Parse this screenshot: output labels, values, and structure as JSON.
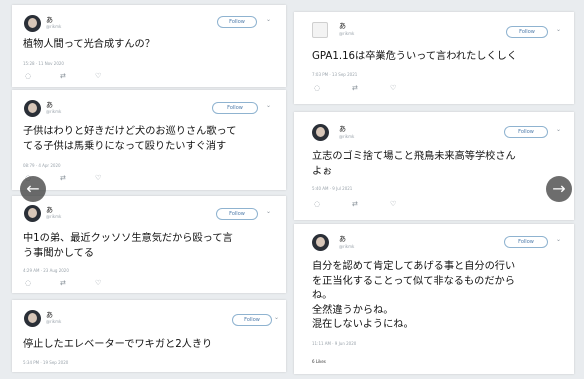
{
  "tweets": [
    {
      "name": "あ",
      "handle": "@rikmk",
      "follow": "Follow",
      "text": "植物人間って光合成すんの？",
      "meta": "15:28 · 11 Nov 2020"
    },
    {
      "name": "あ",
      "handle": "@rikmk",
      "follow": "Follow",
      "text": "子供はわりと好きだけど犬のお巡りさん歌って\nてる子供は馬乗りになって殴りたいすぐ消す",
      "meta": "08:79 · 4 Apr 2020"
    },
    {
      "name": "あ",
      "handle": "@rikmk",
      "follow": "Follow",
      "text": "中1の弟、最近クッソソ生意気だから殴って言\nう事聞かしてる",
      "meta": "4:29 AM · 23 Aug 2020"
    },
    {
      "name": "あ",
      "handle": "@rikmk",
      "follow": "Follow",
      "text": "停止したエレベーターでワキガと2人きり",
      "meta": "5:34 PM · 19 Sep 2020"
    },
    {
      "name": "あ",
      "handle": "@rikmk",
      "follow": "Follow",
      "text": "GPA1.16は卒業危ういって言われたしくしく",
      "meta": "7:03 PM · 13 Sep 2021"
    },
    {
      "name": "あ",
      "handle": "@rikmk",
      "follow": "Follow",
      "text": "立志のゴミ捨て場こと飛鳥未来高等学校さん\nよぉ",
      "meta": "5:40 AM · 9 Jul 2021"
    },
    {
      "name": "あ",
      "handle": "@rikmk",
      "follow": "Follow",
      "text": "自分を認めて肯定してあげる事と自分の行い\nを正当化することって似て非なるものだから\nね。\n全然違うからね。\n混在しないようにね。",
      "meta": "11:11 AM · 9 Jun 2020",
      "likes": "6 Likes"
    }
  ],
  "icons": {
    "reply": "comment-icon",
    "retweet": "retweet-icon",
    "like": "heart-icon",
    "chevron": "chevron-down-icon",
    "prev": "arrow-left-icon",
    "next": "arrow-right-icon"
  },
  "nav": {
    "prev": "←",
    "next": "→"
  },
  "actions": {
    "reply": "◌",
    "retweet": "⇄",
    "like": "♡",
    "chevron": "⌄"
  }
}
